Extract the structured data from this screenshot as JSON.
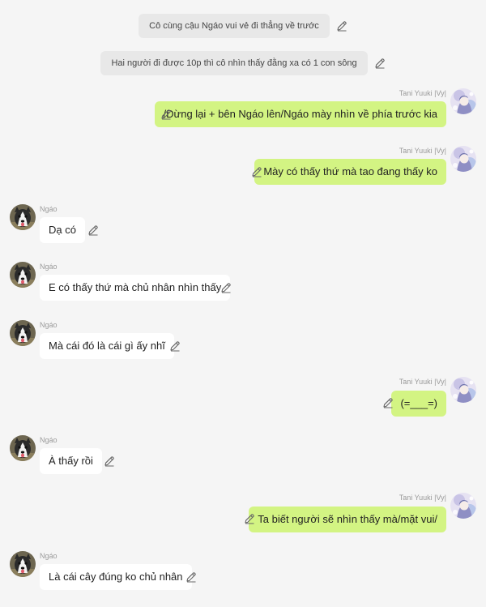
{
  "narrations": [
    {
      "text": "Cô cùng cậu Ngáo vui vẻ đi thẳng về trước"
    },
    {
      "text": "Hai người đi được 10p thì cô nhìn thấy đằng xa có 1 con sông"
    }
  ],
  "messages": [
    {
      "sender": "Tani Yuuki |Vy|",
      "text": "/Dừng lại + bên Ngáo lên/Ngáo mày nhìn về phía trước kia"
    },
    {
      "sender": "Tani Yuuki |Vy|",
      "text": "Mày có thấy thứ mà tao đang thấy ko"
    },
    {
      "sender": "Ngáo",
      "text": "Dạ có"
    },
    {
      "sender": "Ngáo",
      "text": "E có thấy thứ mà chủ nhân nhìn thấy"
    },
    {
      "sender": "Ngáo",
      "text": "Mà cái đó là cái gì ấy nhĩ"
    },
    {
      "sender": "Tani Yuuki |Vy|",
      "text": "(=___=)"
    },
    {
      "sender": "Ngáo",
      "text": "À thấy rồi"
    },
    {
      "sender": "Tani Yuuki |Vy|",
      "text": "Ta biết người sẽ nhìn thấy mà/mặt vui/"
    },
    {
      "sender": "Ngáo",
      "text": "Là cái cây đúng ko chủ nhân"
    }
  ],
  "icons": {
    "edit": "pencil-icon",
    "avatar_user": "anime-girl-avatar",
    "avatar_bot": "husky-dog-avatar"
  },
  "colors": {
    "background": "#f5f5f5",
    "outgoing_bubble": "#d3f483",
    "incoming_bubble": "#ffffff",
    "narration_bubble": "#e8e8e8"
  }
}
